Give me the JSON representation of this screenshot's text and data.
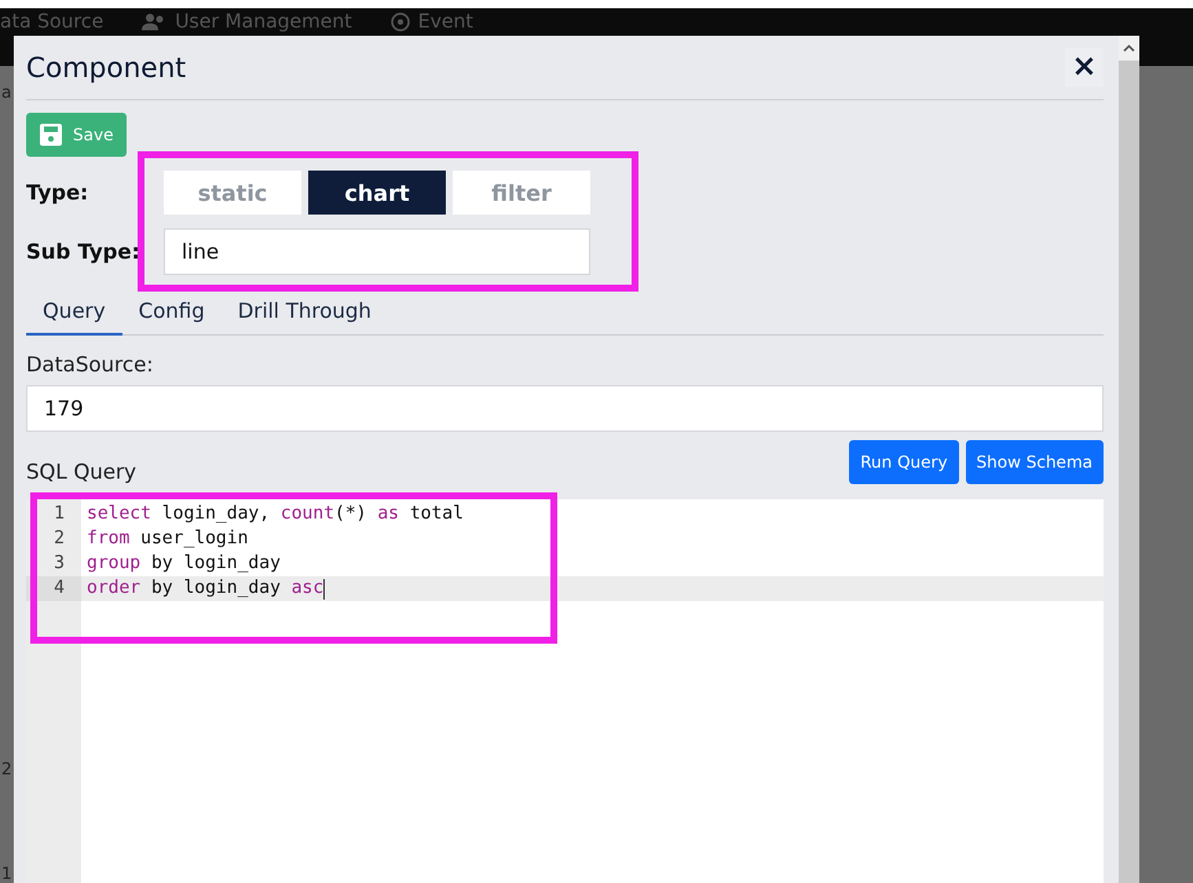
{
  "navbar": {
    "items": [
      {
        "label": "ata Source",
        "kind": "plain"
      },
      {
        "label": "User Management",
        "kind": "users"
      },
      {
        "label": "Event",
        "kind": "target"
      }
    ]
  },
  "background_fragments": [
    "a",
    "2",
    "1"
  ],
  "modal": {
    "title": "Component",
    "close": "×",
    "save_button": "Save",
    "type": {
      "label": "Type:",
      "options": [
        {
          "label": "static",
          "selected": false
        },
        {
          "label": "chart",
          "selected": true
        },
        {
          "label": "filter",
          "selected": false
        }
      ]
    },
    "sub_type": {
      "label": "Sub Type:",
      "value": "line"
    },
    "tabs": [
      {
        "label": "Query",
        "selected": true
      },
      {
        "label": "Config",
        "selected": false
      },
      {
        "label": "Drill Through",
        "selected": false
      }
    ],
    "datasource": {
      "label": "DataSource:",
      "value": "179"
    },
    "sql": {
      "label": "SQL Query",
      "buttons": [
        "Run Query",
        "Show Schema"
      ],
      "lines": [
        {
          "number": "1",
          "active": false,
          "tokens": [
            {
              "text": "select",
              "kind": "keyword"
            },
            {
              "text": " login_day, ",
              "kind": "plain"
            },
            {
              "text": "count",
              "kind": "keyword"
            },
            {
              "text": "(*) ",
              "kind": "plain"
            },
            {
              "text": "as",
              "kind": "keyword"
            },
            {
              "text": " total",
              "kind": "plain"
            }
          ]
        },
        {
          "number": "2",
          "active": false,
          "tokens": [
            {
              "text": "from",
              "kind": "keyword"
            },
            {
              "text": " user_login",
              "kind": "plain"
            }
          ]
        },
        {
          "number": "3",
          "active": false,
          "tokens": [
            {
              "text": "group",
              "kind": "keyword"
            },
            {
              "text": " by ",
              "kind": "plain"
            },
            {
              "text": "login_day",
              "kind": "plain"
            }
          ]
        },
        {
          "number": "4",
          "active": true,
          "tokens": [
            {
              "text": "order",
              "kind": "keyword"
            },
            {
              "text": " by ",
              "kind": "plain"
            },
            {
              "text": "login_day ",
              "kind": "plain"
            },
            {
              "text": "asc",
              "kind": "keyword"
            }
          ]
        }
      ]
    }
  }
}
